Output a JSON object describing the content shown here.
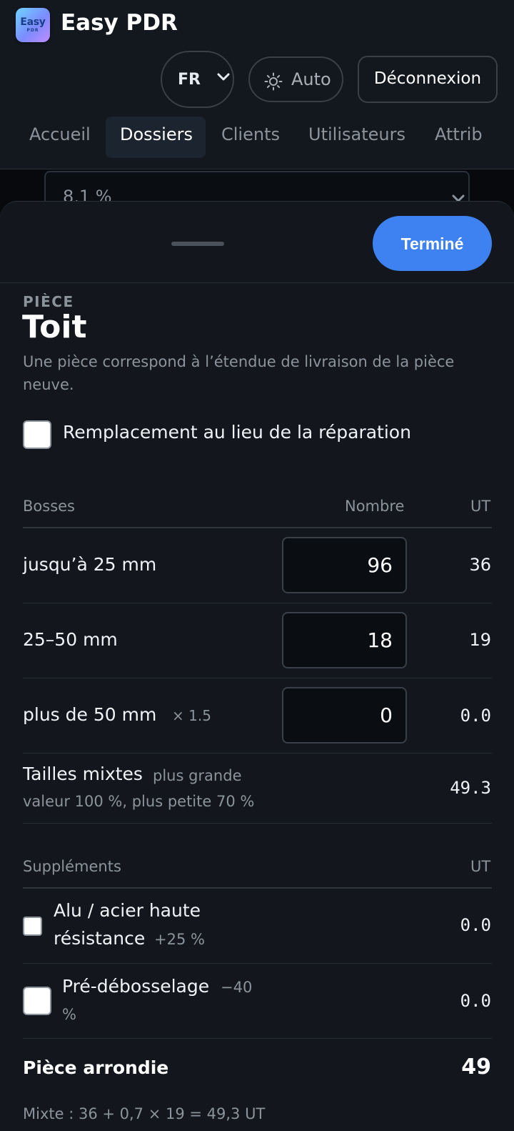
{
  "app": {
    "logo_line1": "Easy",
    "logo_line2": "PDR",
    "title": "Easy PDR"
  },
  "header": {
    "language": "FR",
    "theme_label": "Auto",
    "logout_label": "Déconnexion"
  },
  "nav": {
    "items": [
      {
        "label": "Accueil",
        "active": false
      },
      {
        "label": "Dossiers",
        "active": true
      },
      {
        "label": "Clients",
        "active": false
      },
      {
        "label": "Utilisateurs",
        "active": false
      },
      {
        "label": "Attrib",
        "active": false
      }
    ]
  },
  "background": {
    "select_value": "8,1 %"
  },
  "sheet": {
    "done_label": "Terminé",
    "eyebrow": "PIÈCE",
    "title": "Toit",
    "description": "Une pièce correspond à l’étendue de livraison de la pièce neuve.",
    "replacement_label": "Remplacement au lieu de la réparation",
    "replacement_checked": false,
    "dents": {
      "headers": {
        "label": "Bosses",
        "count": "Nombre",
        "ut": "UT"
      },
      "rows": [
        {
          "label": "jusqu’à 25 mm",
          "multiplier": "",
          "count": "96",
          "ut": "36"
        },
        {
          "label": "25–50 mm",
          "multiplier": "",
          "count": "18",
          "ut": "19"
        },
        {
          "label": "plus de 50 mm",
          "multiplier": "× 1.5",
          "count": "0",
          "ut": "0.0"
        }
      ],
      "mixed": {
        "label": "Tailles mixtes",
        "note_1": "plus grande",
        "note_2": "valeur 100 %, plus petite 70 %",
        "ut": "49.3"
      }
    },
    "extras": {
      "headers": {
        "label": "Suppléments",
        "ut": "UT"
      },
      "rows": [
        {
          "label_1": "Alu / acier haute",
          "label_2": "résistance",
          "modifier": "+25 %",
          "ut": "0.0",
          "checked": false
        },
        {
          "label_1": "Pré-débosselage",
          "modifier_1": "−40",
          "modifier_2": "%",
          "ut": "0.0",
          "checked": false
        }
      ]
    },
    "rounded": {
      "label": "Pièce arrondie",
      "value": "49"
    },
    "formula": "Mixte : 36 + 0,7 × 19 = 49,3 UT"
  },
  "colors": {
    "accent": "#3d82f0",
    "background": "#0f141b",
    "sheet": "#13171d"
  }
}
